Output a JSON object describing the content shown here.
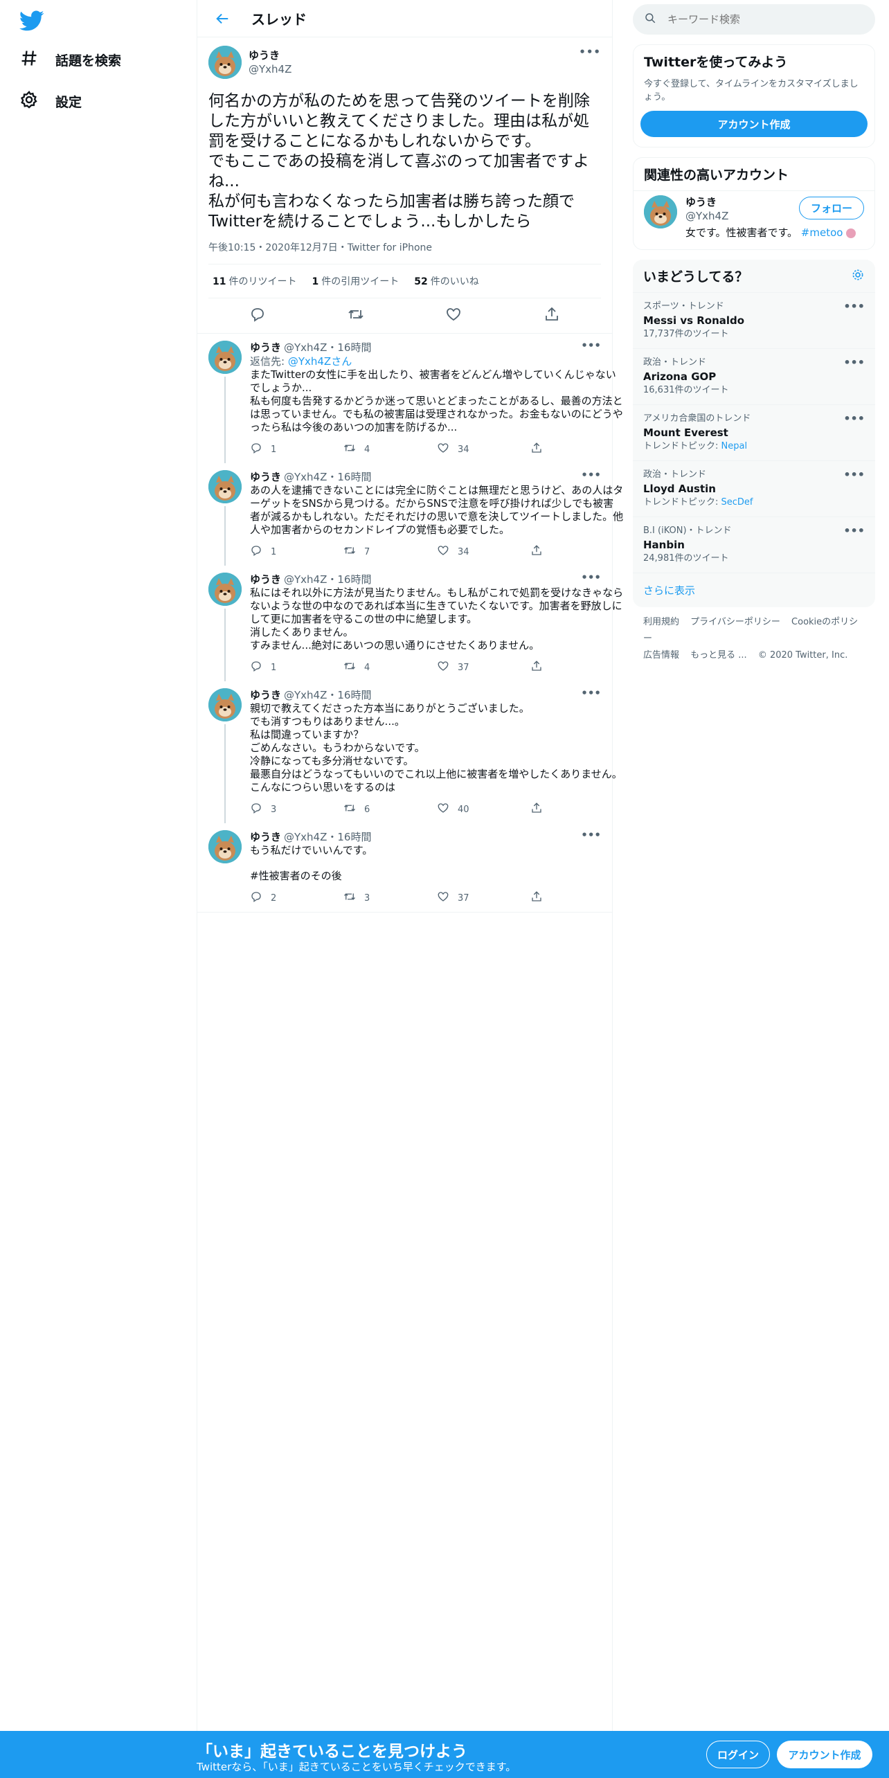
{
  "nav": {
    "explore_label": "話題を検索",
    "settings_label": "設定"
  },
  "header": {
    "title": "スレッド"
  },
  "focal": {
    "name": "ゆうき",
    "handle": "@Yxh4Z",
    "text": "何名かの方が私のためを思って告発のツイートを削除した方がいいと教えてくださりました。理由は私が処罰を受けることになるかもしれないからです。\nでもここであの投稿を消して喜ぶのって加害者ですよね...\n私が何も言わなくなったら加害者は勝ち誇った顔でTwitterを続けることでしょう...もしかしたら",
    "meta": "午後10:15・2020年12月7日・Twitter for iPhone",
    "retweets_count": "11",
    "retweets_label": "件のリツイート",
    "quotes_count": "1",
    "quotes_label": "件の引用ツイート",
    "likes_count": "52",
    "likes_label": "件のいいね"
  },
  "replies": [
    {
      "name": "ゆうき",
      "handle": "@Yxh4Z",
      "time": "・16時間",
      "reply_to_label": "返信先: ",
      "reply_to_handle": "@Yxh4Zさん",
      "text": "またTwitterの女性に手を出したり、被害者をどんどん増やしていくんじゃないでしょうか...\n私も何度も告発するかどうか迷って思いとどまったことがあるし、最善の方法とは思っていません。でも私の被害届は受理されなかった。お金もないのにどうやったら私は今後のあいつの加害を防げるか...",
      "replies": "1",
      "retweets": "4",
      "likes": "34"
    },
    {
      "name": "ゆうき",
      "handle": "@Yxh4Z",
      "time": "・16時間",
      "text": "あの人を逮捕できないことには完全に防ぐことは無理だと思うけど、あの人はターゲットをSNSから見つける。だからSNSで注意を呼び掛ければ少しでも被害者が減るかもしれない。ただそれだけの思いで意を決してツイートしました。他人や加害者からのセカンドレイプの覚悟も必要でした。",
      "replies": "1",
      "retweets": "7",
      "likes": "34"
    },
    {
      "name": "ゆうき",
      "handle": "@Yxh4Z",
      "time": "・16時間",
      "text": "私にはそれ以外に方法が見当たりません。もし私がこれで処罰を受けなきゃならないような世の中なのであれば本当に生きていたくないです。加害者を野放しにして更に加害者を守るこの世の中に絶望します。\n消したくありません。\nすみません...絶対にあいつの思い通りにさせたくありません。",
      "replies": "1",
      "retweets": "4",
      "likes": "37"
    },
    {
      "name": "ゆうき",
      "handle": "@Yxh4Z",
      "time": "・16時間",
      "text": "親切で教えてくださった方本当にありがとうございました。\nでも消すつもりはありません...。\n私は間違っていますか？\nごめんなさい。もうわからないです。\n冷静になっても多分消せないです。\n最悪自分はどうなってもいいのでこれ以上他に被害者を増やしたくありません。こんなにつらい思いをするのは",
      "replies": "3",
      "retweets": "6",
      "likes": "40"
    },
    {
      "name": "ゆうき",
      "handle": "@Yxh4Z",
      "time": "・16時間",
      "text": "もう私だけでいいんです。",
      "hashtag": "#性被害者のその後",
      "replies": "2",
      "retweets": "3",
      "likes": "37"
    }
  ],
  "search": {
    "placeholder": "キーワード検索"
  },
  "signup_card": {
    "title": "Twitterを使ってみよう",
    "desc": "今すぐ登録して、タイムラインをカスタマイズしましょう。",
    "button": "アカウント作成"
  },
  "related": {
    "title": "関連性の高いアカウント",
    "name": "ゆうき",
    "handle": "@Yxh4Z",
    "bio": "女です。性被害者です。",
    "bio_tag": "#metoo",
    "follow": "フォロー"
  },
  "trends": {
    "title": "いまどうしてる？",
    "items": [
      {
        "category": "スポーツ・トレンド",
        "name": "Messi vs Ronaldo",
        "sub": "17,737件のツイート"
      },
      {
        "category": "政治・トレンド",
        "name": "Arizona GOP",
        "sub": "16,631件のツイート"
      },
      {
        "category": "アメリカ合衆国のトレンド",
        "name": "Mount Everest",
        "sub_label": "トレンドトピック: ",
        "sub_link": "Nepal"
      },
      {
        "category": "政治・トレンド",
        "name": "Lloyd Austin",
        "sub_label": "トレンドトピック: ",
        "sub_link": "SecDef"
      },
      {
        "category": "B.I (iKON)・トレンド",
        "name": "Hanbin",
        "sub": "24,981件のツイート"
      }
    ],
    "show_more": "さらに表示"
  },
  "footer": {
    "terms": "利用規約",
    "privacy": "プライバシーポリシー",
    "cookie": "Cookieのポリシー",
    "ads": "広告情報",
    "more": "もっと見る ...",
    "copyright": "© 2020 Twitter, Inc."
  },
  "bottom_bar": {
    "title": "「いま」起きていることを見つけよう",
    "sub": "Twitterなら、「いま」起きていることをいち早くチェックできます。",
    "login": "ログイン",
    "signup": "アカウント作成"
  },
  "colors": {
    "accent": "#1d9bf0",
    "text_secondary": "#536471"
  }
}
